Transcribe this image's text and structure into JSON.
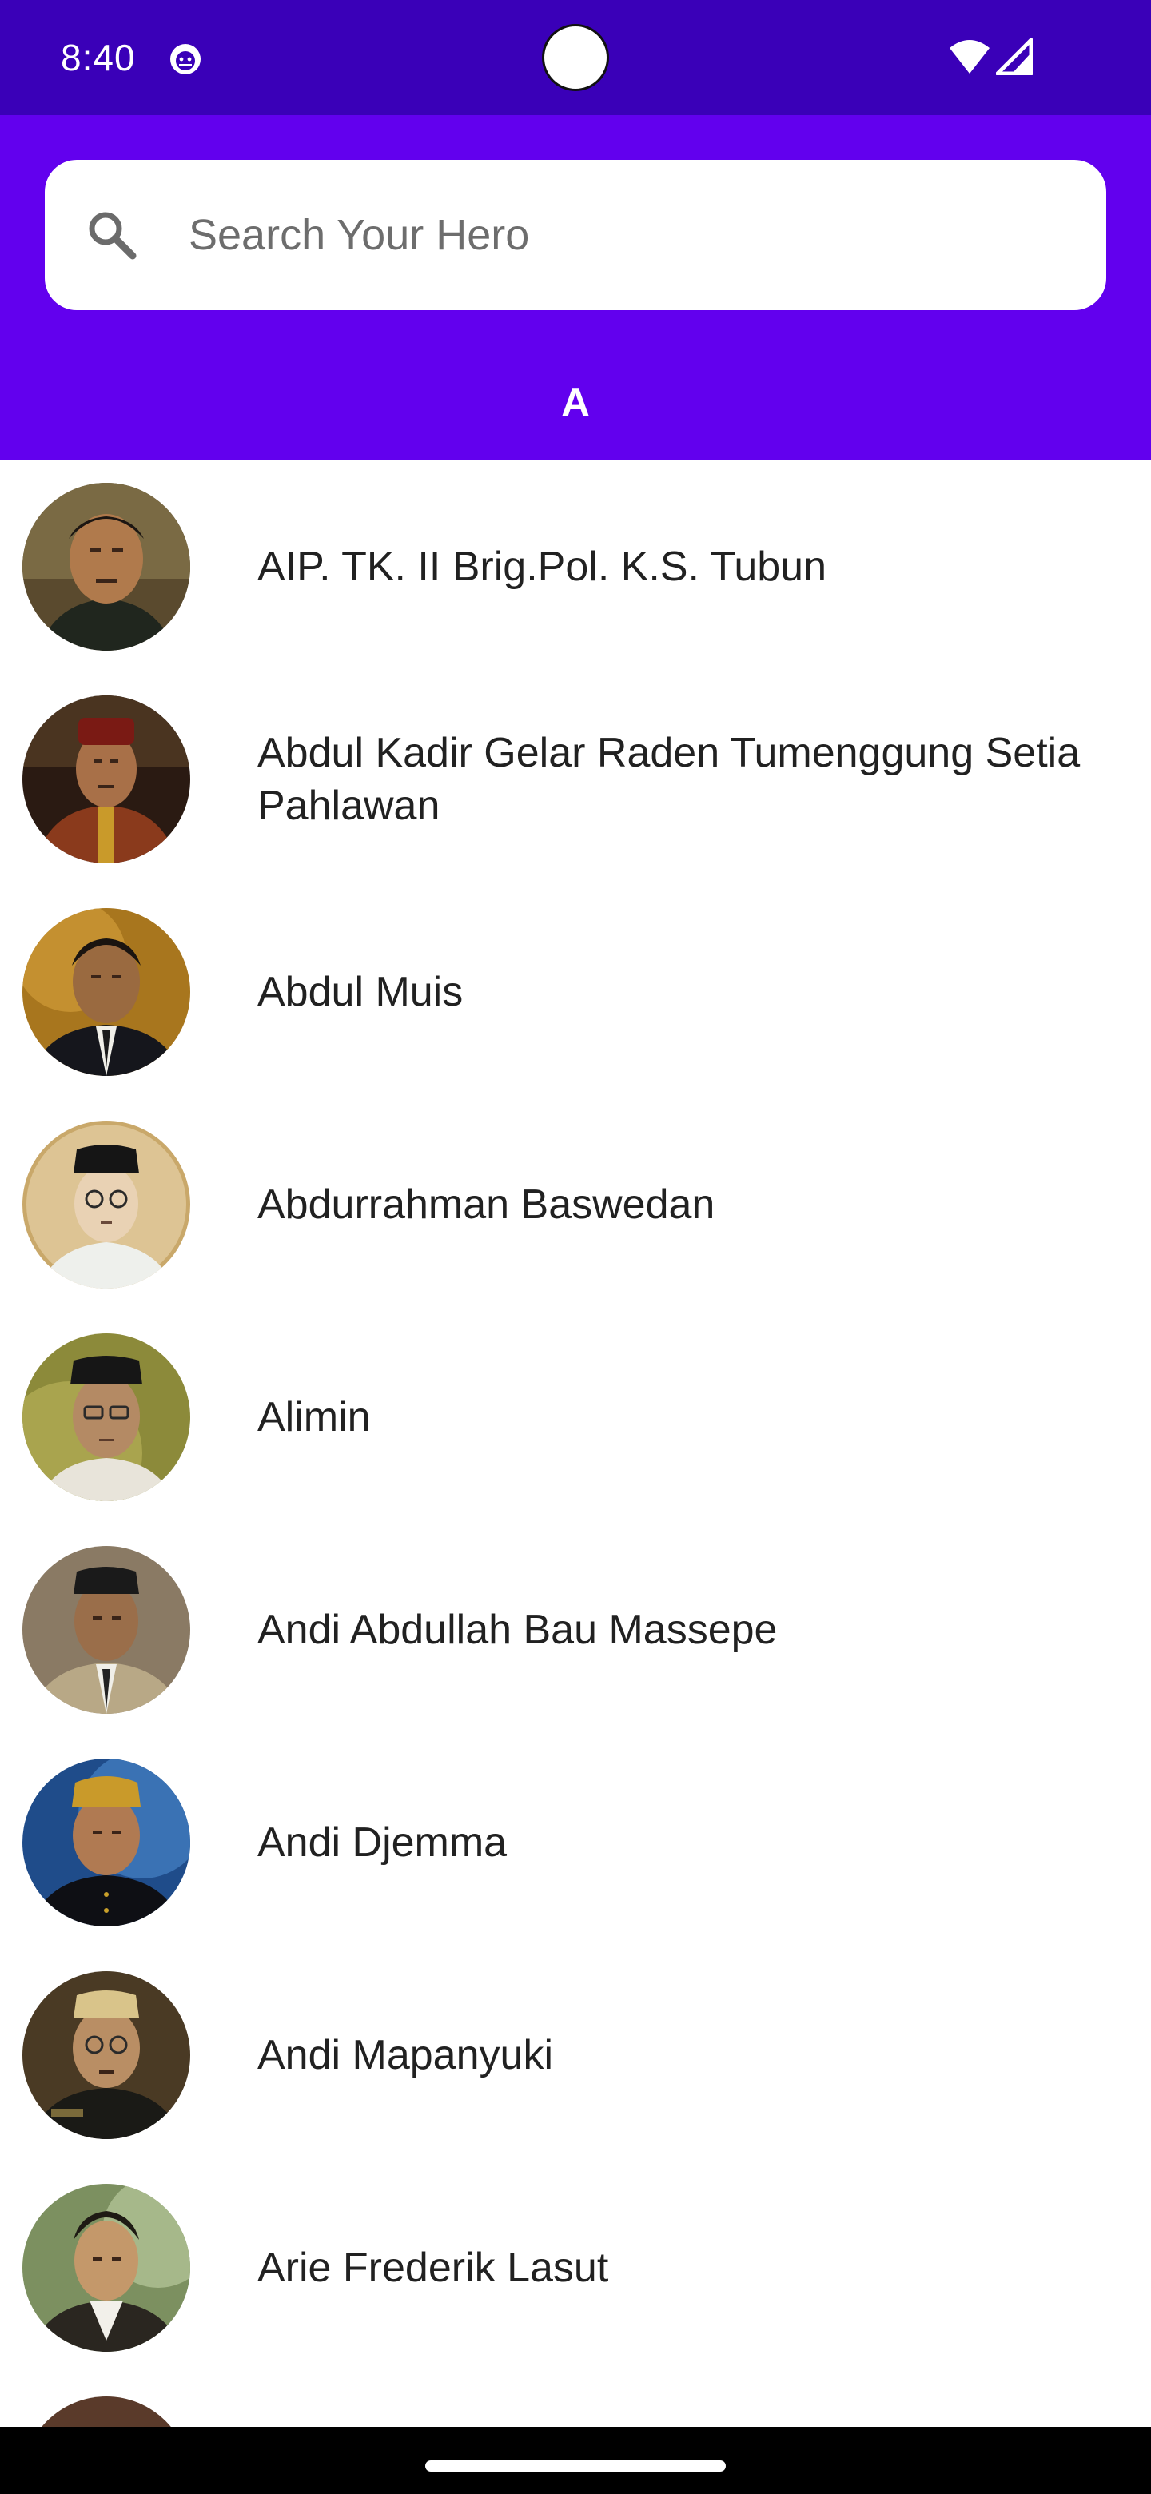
{
  "status_bar": {
    "time": "8:40",
    "app_icon": "android-debug-icon",
    "wifi_icon": "wifi-icon",
    "signal_icon": "cell-signal-icon",
    "background": "#3a00b8"
  },
  "search": {
    "placeholder": "Search Your Hero",
    "value": "",
    "icon": "search-icon"
  },
  "section": {
    "letter": "A"
  },
  "heroes": [
    {
      "name": "AIP. TK. II Brig.Pol. K.S. Tubun"
    },
    {
      "name": "Abdul Kadir Gelar Raden Tumenggung Setia Pahlawan"
    },
    {
      "name": "Abdul Muis"
    },
    {
      "name": "Abdurrahman Baswedan"
    },
    {
      "name": "Alimin"
    },
    {
      "name": "Andi Abdullah Bau Massepe"
    },
    {
      "name": "Andi Djemma"
    },
    {
      "name": "Andi Mapanyuki"
    },
    {
      "name": "Arie Frederik Lasut"
    }
  ],
  "colors": {
    "header": "#6200ee",
    "status": "#3a00b8",
    "text": "#212121"
  }
}
